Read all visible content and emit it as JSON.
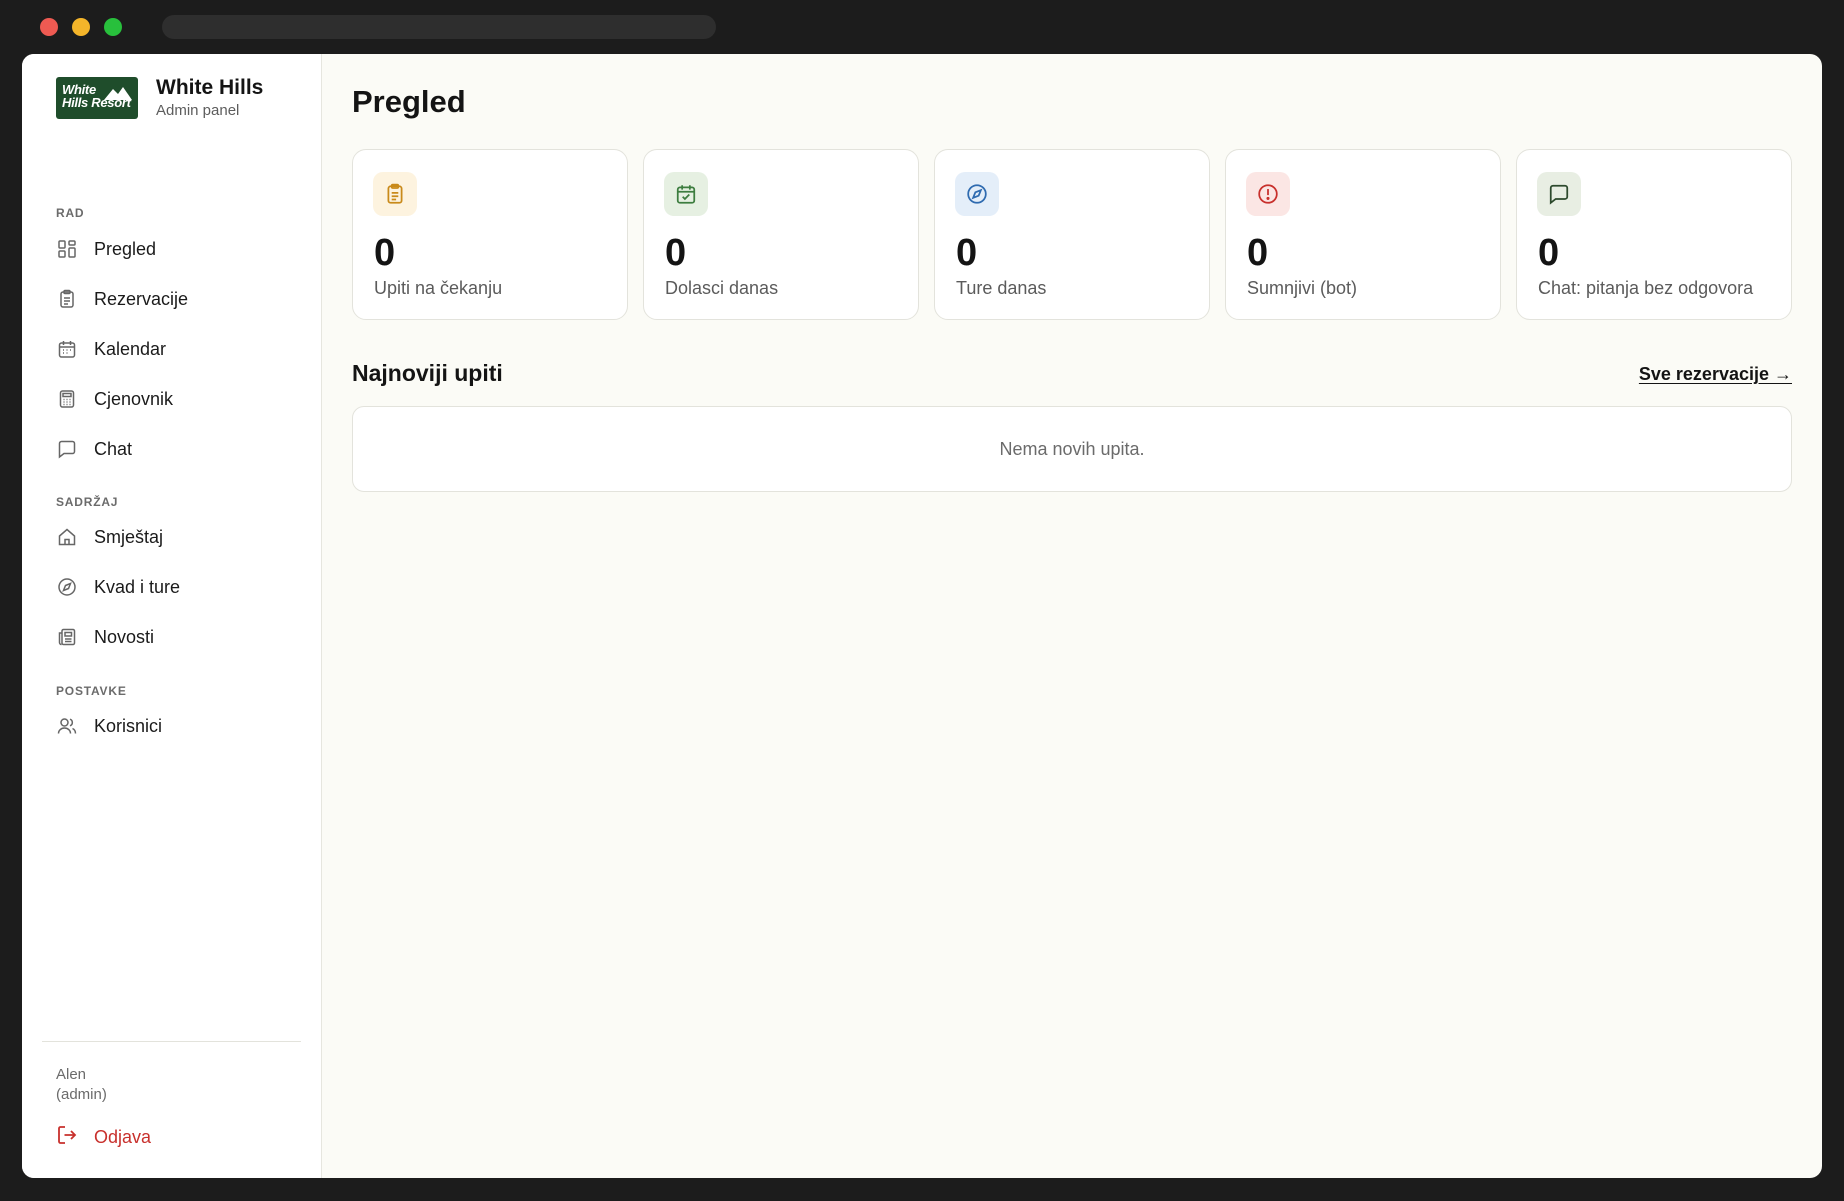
{
  "brand": {
    "logo_text_1": "White",
    "logo_text_2": "Hills Resort",
    "name": "White Hills",
    "subtitle": "Admin panel"
  },
  "sidebar": {
    "sections": [
      {
        "label": "RAD",
        "items": [
          {
            "label": "Pregled",
            "icon": "grid-icon"
          },
          {
            "label": "Rezervacije",
            "icon": "clipboard-icon"
          },
          {
            "label": "Kalendar",
            "icon": "calendar-icon"
          },
          {
            "label": "Cjenovnik",
            "icon": "calculator-icon"
          },
          {
            "label": "Chat",
            "icon": "chat-icon"
          }
        ]
      },
      {
        "label": "SADRŽAJ",
        "items": [
          {
            "label": "Smještaj",
            "icon": "home-icon"
          },
          {
            "label": "Kvad i ture",
            "icon": "compass-icon"
          },
          {
            "label": "Novosti",
            "icon": "newspaper-icon"
          }
        ]
      },
      {
        "label": "POSTAVKE",
        "items": [
          {
            "label": "Korisnici",
            "icon": "users-icon"
          }
        ]
      }
    ],
    "user": {
      "name": "Alen",
      "role": "(admin)"
    },
    "logout_label": "Odjava"
  },
  "main": {
    "title": "Pregled",
    "stats": [
      {
        "value": "0",
        "label": "Upiti na čekanju",
        "icon": "clipboard-icon",
        "color": "#c98a1a",
        "bg": "#fdf3df"
      },
      {
        "value": "0",
        "label": "Dolasci danas",
        "icon": "calendar-check-icon",
        "color": "#3d7d3f",
        "bg": "#e6f0e2"
      },
      {
        "value": "0",
        "label": "Ture danas",
        "icon": "compass-icon",
        "color": "#2f6bb0",
        "bg": "#e4eef9"
      },
      {
        "value": "0",
        "label": "Sumnjivi (bot)",
        "icon": "alert-circle-icon",
        "color": "#c8302c",
        "bg": "#fbe6e4"
      },
      {
        "value": "0",
        "label": "Chat: pitanja bez odgovora",
        "icon": "chat-icon",
        "color": "#2d4a2d",
        "bg": "#e8eee3"
      }
    ],
    "recent_title": "Najnoviji upiti",
    "all_link": "Sve rezervacije →",
    "empty_text": "Nema novih upita."
  },
  "colors": {
    "brand_green": "#1f4d2b",
    "danger": "#c8302c",
    "background": "#fbfbf6"
  }
}
